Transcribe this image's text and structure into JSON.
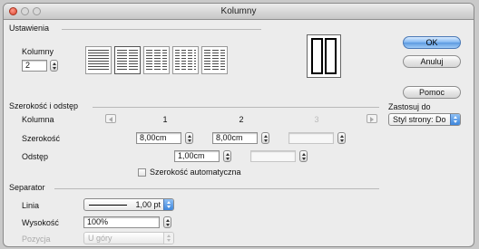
{
  "window": {
    "title": "Kolumny"
  },
  "ustawienia": {
    "section_label": "Ustawienia",
    "kolumny_label": "Kolumny",
    "kolumny_value": "2"
  },
  "buttons": {
    "ok": "OK",
    "cancel": "Anuluj",
    "help": "Pomoc"
  },
  "apply_to": {
    "label": "Zastosuj do",
    "value": "Styl strony: Do"
  },
  "width_spacing": {
    "section_label": "Szerokość i odstęp",
    "column_label": "Kolumna",
    "column_numbers": [
      "1",
      "2",
      "3"
    ],
    "width_label": "Szerokość",
    "widths": [
      "8,00cm",
      "8,00cm",
      ""
    ],
    "spacing_label": "Odstęp",
    "spacings": [
      "1,00cm",
      ""
    ],
    "auto_width_label": "Szerokość automatyczna"
  },
  "separator": {
    "section_label": "Separator",
    "line_label": "Linia",
    "line_value": "1,00 pt",
    "height_label": "Wysokość",
    "height_value": "100%",
    "position_label": "Pozycja",
    "position_value": "U góry"
  },
  "colors": {
    "accent": "#5c9ae0",
    "close_button": "#d9432e"
  },
  "icons": [
    "one-column-layout-icon",
    "two-column-layout-icon",
    "three-column-layout-icon",
    "four-column-layout-icon",
    "five-column-layout-icon",
    "left-arrow-icon",
    "right-arrow-icon"
  ]
}
